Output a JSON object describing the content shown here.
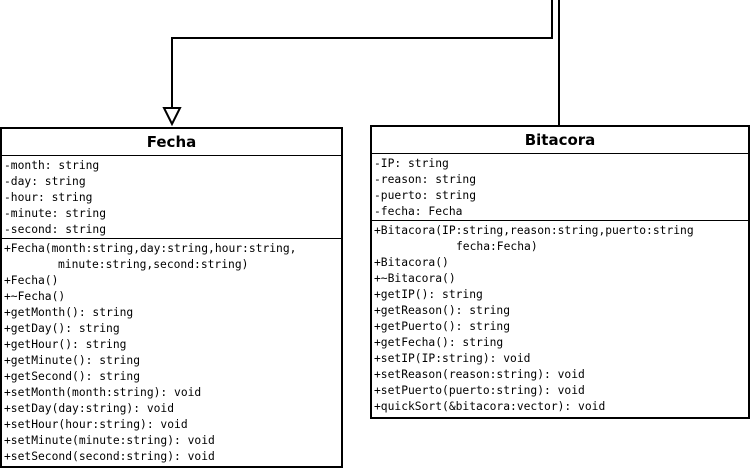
{
  "classes": {
    "fecha": {
      "name": "Fecha",
      "attributes": [
        "-month: string",
        "-day: string",
        "-hour: string",
        "-minute: string",
        "-second: string"
      ],
      "methods": [
        "+Fecha(month:string,day:string,hour:string,",
        "minute:string,second:string)",
        "+Fecha()",
        "+~Fecha()",
        "+getMonth(): string",
        "+getDay(): string",
        "+getHour(): string",
        "+getMinute(): string",
        "+getSecond(): string",
        "+setMonth(month:string): void",
        "+setDay(day:string): void",
        "+setHour(hour:string): void",
        "+setMinute(minute:string): void",
        "+setSecond(second:string): void"
      ]
    },
    "bitacora": {
      "name": "Bitacora",
      "attributes": [
        "-IP: string",
        "-reason: string",
        "-puerto: string",
        "-fecha: Fecha"
      ],
      "methods": [
        "+Bitacora(IP:string,reason:string,puerto:string",
        "fecha:Fecha)",
        "+Bitacora()",
        "+~Bitacora()",
        "+getIP(): string",
        "+getReason(): string",
        "+getPuerto(): string",
        "+getFecha(): string",
        "+setIP(IP:string): void",
        "+setReason(reason:string): void",
        "+setPuerto(puerto:string): void",
        "+quickSort(&bitacora:vector): void"
      ]
    }
  },
  "colors": {
    "line": "#000000",
    "background": "#ffffff"
  }
}
